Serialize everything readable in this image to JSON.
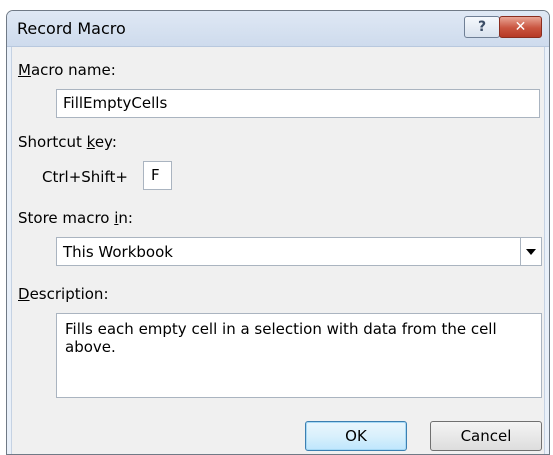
{
  "window": {
    "title": "Record Macro",
    "help_label": "?",
    "close_label": "✕"
  },
  "macro_name": {
    "label_accel": "M",
    "label_rest": "acro name:",
    "value": "FillEmptyCells"
  },
  "shortcut": {
    "label_pre": "Shortcut ",
    "label_accel": "k",
    "label_post": "ey:",
    "prefix": "Ctrl+Shift+",
    "value": "F"
  },
  "store": {
    "label_pre": "Store macro ",
    "label_accel": "i",
    "label_post": "n:",
    "selected": "This Workbook"
  },
  "description": {
    "label_accel": "D",
    "label_rest": "escription:",
    "value": "Fills each empty cell in a selection with data from the cell above."
  },
  "buttons": {
    "ok_label": "OK",
    "cancel_label": "Cancel"
  }
}
